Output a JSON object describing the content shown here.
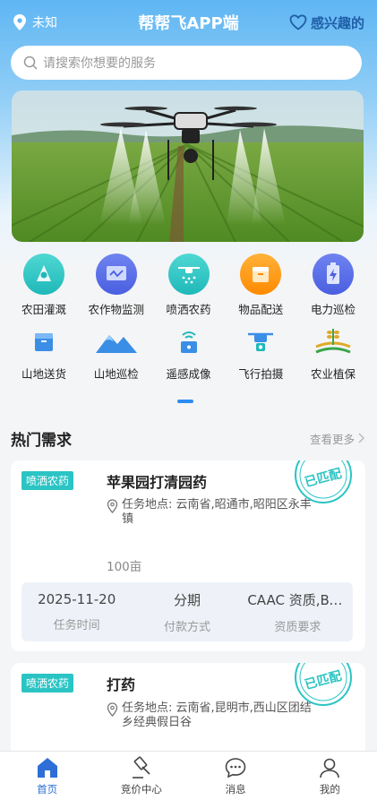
{
  "header": {
    "location": "未知",
    "title": "帮帮飞APP端",
    "interest": "感兴趣的"
  },
  "search": {
    "placeholder": "请搜索你想要的服务"
  },
  "services": [
    [
      {
        "label": "农田灌溉",
        "icon": "irrigation-icon"
      },
      {
        "label": "农作物监测",
        "icon": "crop-monitor-icon"
      },
      {
        "label": "喷洒农药",
        "icon": "spray-drone-icon"
      },
      {
        "label": "物品配送",
        "icon": "delivery-box-icon"
      },
      {
        "label": "电力巡检",
        "icon": "power-inspect-icon"
      }
    ],
    [
      {
        "label": "山地送货",
        "icon": "mountain-delivery-icon"
      },
      {
        "label": "山地巡检",
        "icon": "mountain-icon"
      },
      {
        "label": "遥感成像",
        "icon": "remote-sensing-icon"
      },
      {
        "label": "飞行拍摄",
        "icon": "aerial-camera-icon"
      },
      {
        "label": "农业植保",
        "icon": "wheat-icon"
      }
    ]
  ],
  "hot": {
    "title": "热门需求",
    "more": "查看更多"
  },
  "cards": [
    {
      "tag": "喷洒农药",
      "title": "苹果园打清园药",
      "address": "任务地点: 云南省,昭通市,昭阳区永丰镇",
      "stamp": "已匹配",
      "area": "100亩",
      "date": "2025-11-20",
      "date_label": "任务时间",
      "payment": "分期",
      "payment_label": "付款方式",
      "qualification": "CAAC 资质,BVLOS",
      "qualification_label": "资质要求"
    },
    {
      "tag": "喷洒农药",
      "title": "打药",
      "address": "任务地点: 云南省,昆明市,西山区团结乡经典假日谷",
      "stamp": "已匹配"
    }
  ],
  "tabbar": [
    {
      "label": "首页",
      "icon": "home-icon"
    },
    {
      "label": "竞价中心",
      "icon": "gavel-icon"
    },
    {
      "label": "消息",
      "icon": "chat-icon"
    },
    {
      "label": "我的",
      "icon": "user-icon"
    }
  ],
  "colors": {
    "accent": "#2d8cf0",
    "tag": "#2bc4c4",
    "stamp": "#2bc4c4"
  }
}
